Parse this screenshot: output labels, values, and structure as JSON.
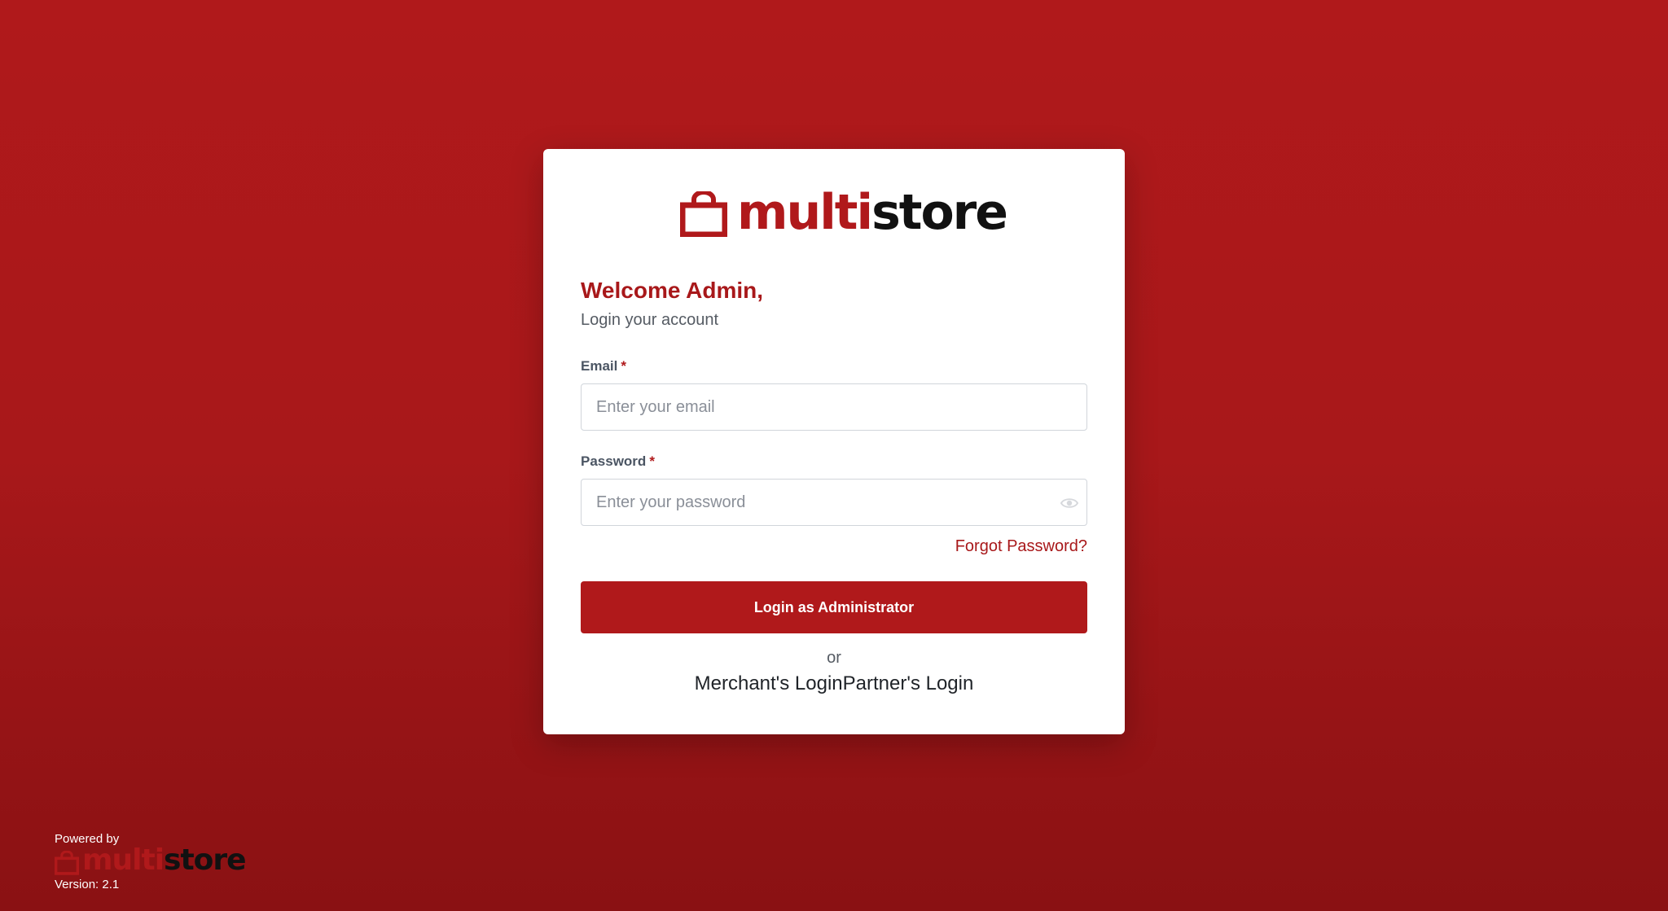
{
  "brand": {
    "name_part1": "multi",
    "name_part2": "store",
    "primary_color": "#b0191b",
    "icon": "shopping-bag-icon"
  },
  "login": {
    "welcome": "Welcome Admin,",
    "subtitle": "Login your account",
    "email_label": "Email",
    "email_placeholder": "Enter your email",
    "email_value": "",
    "password_label": "Password",
    "password_placeholder": "Enter your password",
    "password_value": "",
    "required_mark": "*",
    "forgot_password": "Forgot Password?",
    "submit_label": "Login as Administrator",
    "or_text": "or",
    "merchant_login": "Merchant's Login",
    "partner_login": "Partner's Login"
  },
  "footer": {
    "powered_by": "Powered by",
    "version": "Version: 2.1"
  }
}
